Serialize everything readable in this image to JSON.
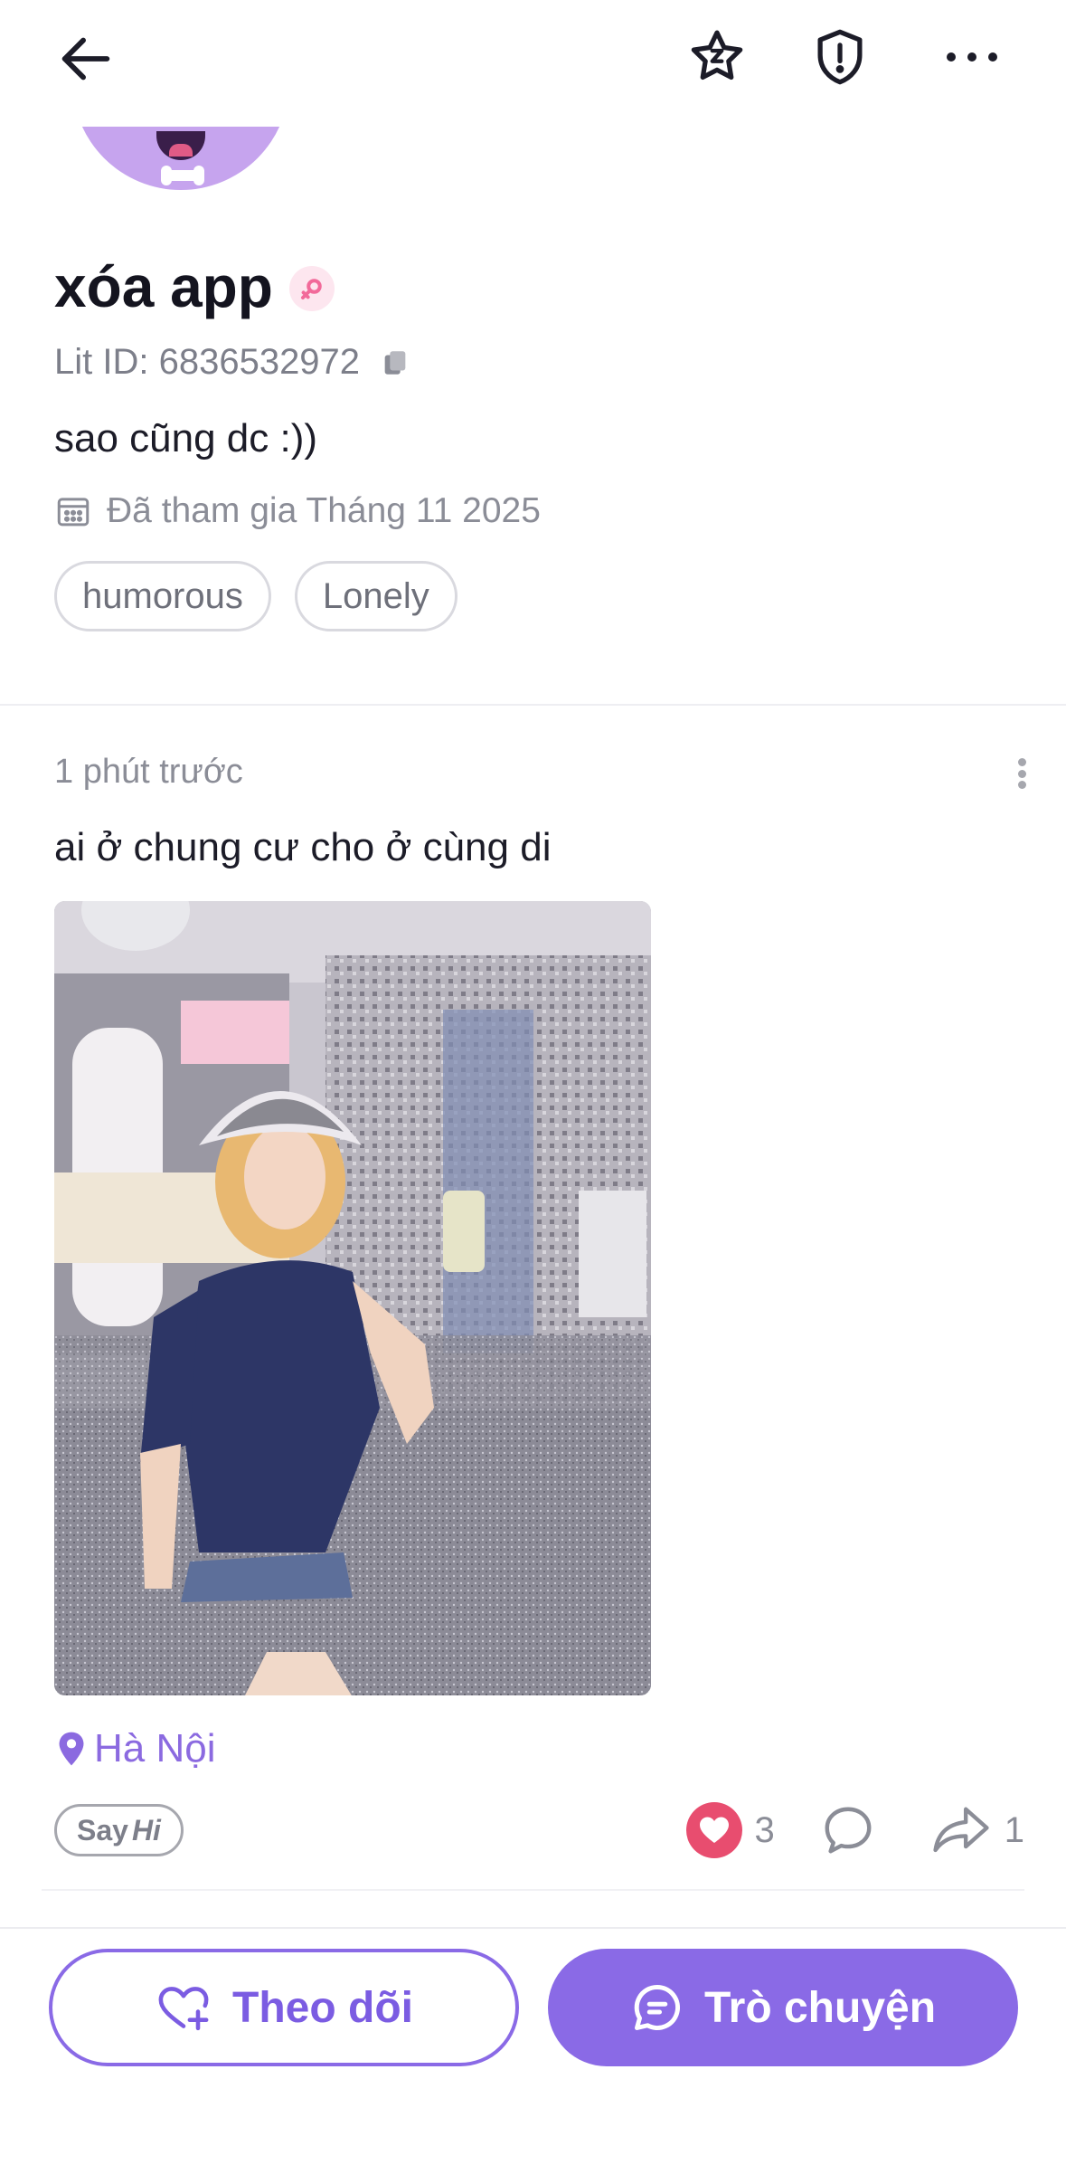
{
  "header": {
    "back_icon": "arrow-left-icon",
    "star_icon": "star-badge-icon",
    "shield_icon": "shield-alert-icon",
    "more_icon": "more-horizontal-icon"
  },
  "profile": {
    "username": "xóa app",
    "gender_icon": "female-symbol-icon",
    "lit_id": "Lit ID: 6836532972",
    "bio": "sao cũng dc :))",
    "joined": "Đã tham gia Tháng 11 2025",
    "tags": [
      "humorous",
      "Lonely"
    ]
  },
  "post": {
    "time": "1 phút trước",
    "text": "ai ở chung cư cho ở cùng di",
    "location": "Hà Nội",
    "say_hi": {
      "say": "Say",
      "hi": "Hi"
    },
    "likes": "3",
    "shares": "1"
  },
  "bottom_bar": {
    "follow_label": "Theo dõi",
    "chat_label": "Trò chuyện"
  },
  "colors": {
    "accent": "#8a6ae6",
    "like": "#e84d6f",
    "text_muted": "#8b8d97"
  }
}
